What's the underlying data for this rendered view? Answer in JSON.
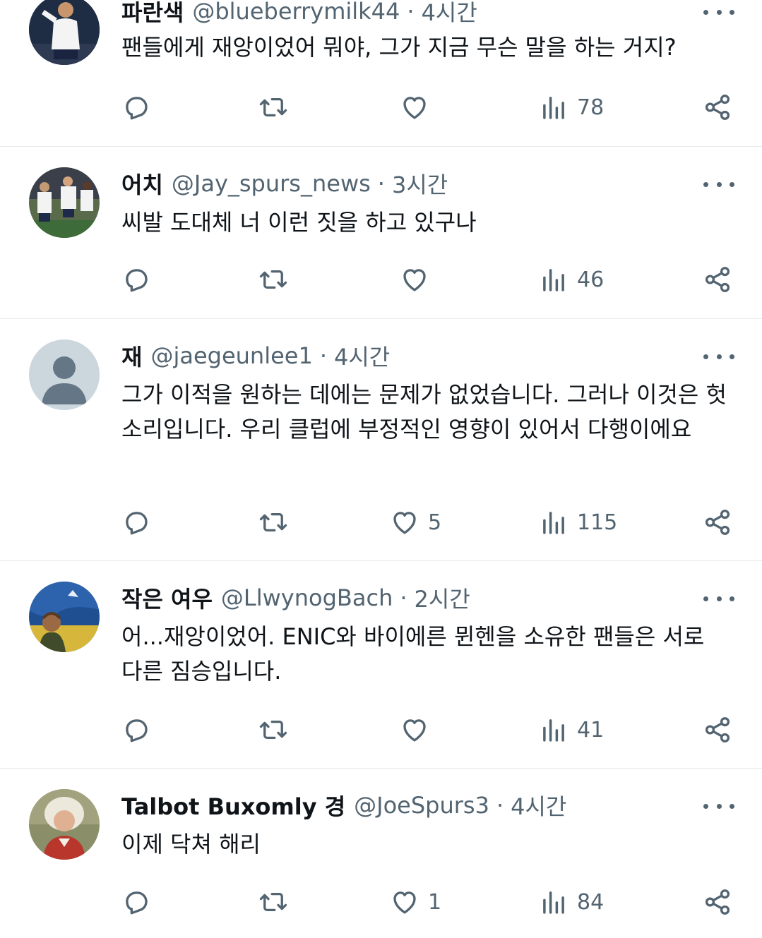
{
  "tweets": [
    {
      "name": "파란색",
      "handle": "@blueberrymilk44",
      "time": "4시간",
      "text": "팬들에게 재앙이었어 뭐야, 그가 지금 무슨 말을 하는 거지?",
      "likes": "",
      "views": "78",
      "avatar": "player-photo-white-kit"
    },
    {
      "name": "어치",
      "handle": "@Jay_spurs_news",
      "time": "3시간",
      "text": "씨발 도대체 너 이런 짓을 하고 있구나",
      "likes": "",
      "views": "46",
      "avatar": "team-celebration-photo"
    },
    {
      "name": "재",
      "handle": "@jaegeunlee1",
      "time": "4시간",
      "text": "그가 이적을 원하는 데에는 문제가 없었습니다. 그러나 이것은 헛소리입니다. 우리 클럽에 부정적인 영향이 있어서 다행이에요",
      "likes": "5",
      "views": "115",
      "avatar": "default-user-silhouette"
    },
    {
      "name": "작은 여우",
      "handle": "@LlwynogBach",
      "time": "2시간",
      "text": "어...재앙이었어. ENIC와 바이에른 뮌헨을 소유한 팬들은 서로 다른 짐승입니다.",
      "likes": "",
      "views": "41",
      "avatar": "painted-portrait"
    },
    {
      "name": "Talbot Buxomly 경",
      "handle": "@JoeSpurs3",
      "time": "4시간",
      "text": "이제 닥쳐 해리",
      "likes": "1",
      "views": "84",
      "avatar": "man-in-powdered-wig"
    }
  ],
  "icons": {
    "reply": "reply-icon",
    "retweet": "retweet-icon",
    "like": "like-icon",
    "views": "views-icon",
    "share": "share-icon",
    "more": "more-icon"
  },
  "colors": {
    "text": "#0f1419",
    "secondary": "#536471",
    "divider": "#e7e9ea"
  }
}
